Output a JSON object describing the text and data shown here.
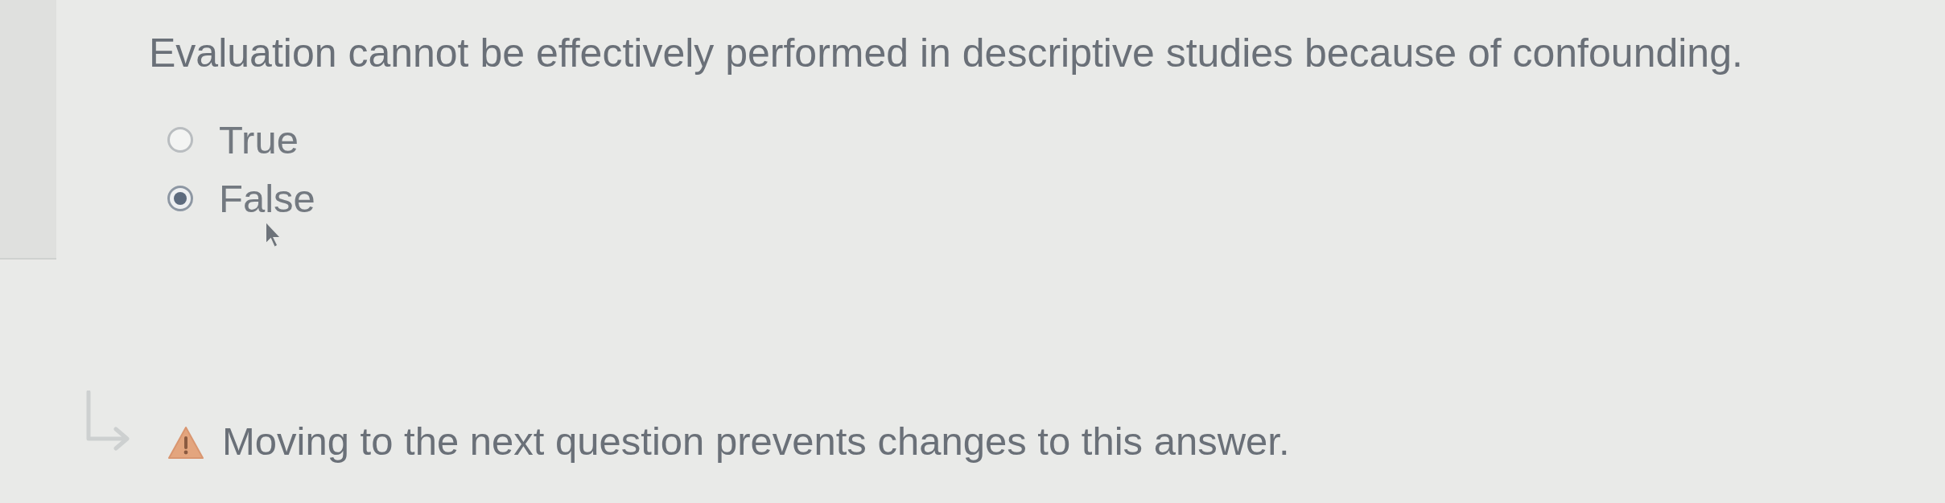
{
  "question": {
    "text": "Evaluation cannot be effectively performed in descriptive studies because of confounding."
  },
  "options": [
    {
      "label": "True",
      "selected": false
    },
    {
      "label": "False",
      "selected": true
    }
  ],
  "notice": {
    "text": "Moving to the next question prevents changes to this answer."
  }
}
